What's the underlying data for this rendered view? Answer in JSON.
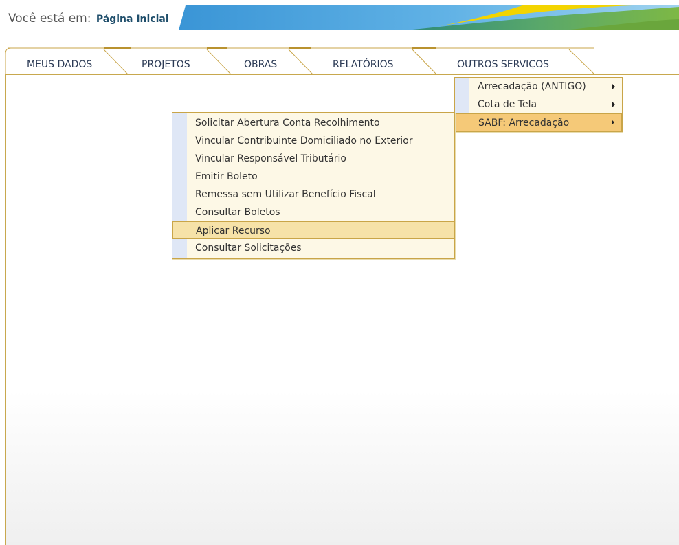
{
  "breadcrumb": {
    "prefix": "Você está em:",
    "current": "Página Inicial"
  },
  "tabs": [
    {
      "label": "MEUS DADOS"
    },
    {
      "label": "PROJETOS"
    },
    {
      "label": "OBRAS"
    },
    {
      "label": "RELATÓRIOS"
    },
    {
      "label": "OUTROS SERVIÇOS"
    }
  ],
  "outros_servicos_menu": [
    {
      "label": "Arrecadação (ANTIGO)",
      "has_submenu": true
    },
    {
      "label": "Cota de Tela",
      "has_submenu": true
    },
    {
      "label": "SABF: Arrecadação",
      "has_submenu": true,
      "highlighted": true
    }
  ],
  "sabf_submenu": [
    {
      "label": "Solicitar Abertura Conta Recolhimento"
    },
    {
      "label": "Vincular Contribuinte Domiciliado no Exterior"
    },
    {
      "label": "Vincular Responsável Tributário"
    },
    {
      "label": "Emitir Boleto"
    },
    {
      "label": "Remessa sem Utilizar Benefício Fiscal"
    },
    {
      "label": "Consultar Boletos"
    },
    {
      "label": "Aplicar Recurso",
      "highlighted": true
    },
    {
      "label": "Consultar Solicitações"
    }
  ],
  "colors": {
    "accent_gold": "#c9a548",
    "menu_bg": "#fdf8e6",
    "menu_stripe": "#dfe7f6",
    "banner_blue": "#2f8fd0",
    "banner_green": "#7ab648",
    "banner_yellow": "#f1d000"
  }
}
